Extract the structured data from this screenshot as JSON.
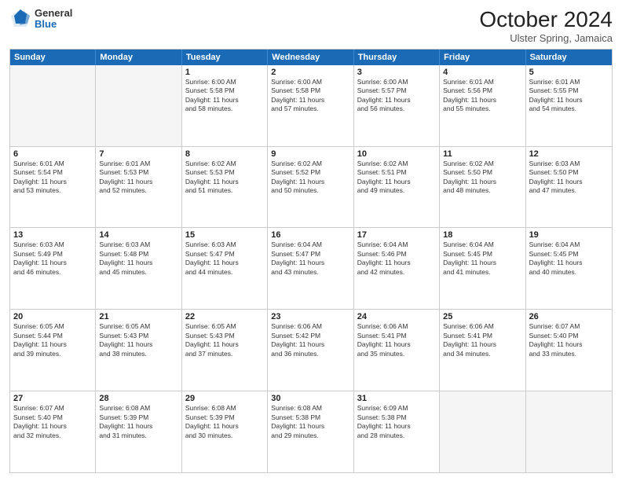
{
  "header": {
    "logo": {
      "general": "General",
      "blue": "Blue"
    },
    "title": "October 2024",
    "location": "Ulster Spring, Jamaica"
  },
  "calendar": {
    "days_of_week": [
      "Sunday",
      "Monday",
      "Tuesday",
      "Wednesday",
      "Thursday",
      "Friday",
      "Saturday"
    ],
    "weeks": [
      [
        {
          "day": "",
          "empty": true
        },
        {
          "day": "",
          "empty": true
        },
        {
          "day": "1",
          "lines": [
            "Sunrise: 6:00 AM",
            "Sunset: 5:58 PM",
            "Daylight: 11 hours",
            "and 58 minutes."
          ]
        },
        {
          "day": "2",
          "lines": [
            "Sunrise: 6:00 AM",
            "Sunset: 5:58 PM",
            "Daylight: 11 hours",
            "and 57 minutes."
          ]
        },
        {
          "day": "3",
          "lines": [
            "Sunrise: 6:00 AM",
            "Sunset: 5:57 PM",
            "Daylight: 11 hours",
            "and 56 minutes."
          ]
        },
        {
          "day": "4",
          "lines": [
            "Sunrise: 6:01 AM",
            "Sunset: 5:56 PM",
            "Daylight: 11 hours",
            "and 55 minutes."
          ]
        },
        {
          "day": "5",
          "lines": [
            "Sunrise: 6:01 AM",
            "Sunset: 5:55 PM",
            "Daylight: 11 hours",
            "and 54 minutes."
          ]
        }
      ],
      [
        {
          "day": "6",
          "lines": [
            "Sunrise: 6:01 AM",
            "Sunset: 5:54 PM",
            "Daylight: 11 hours",
            "and 53 minutes."
          ]
        },
        {
          "day": "7",
          "lines": [
            "Sunrise: 6:01 AM",
            "Sunset: 5:53 PM",
            "Daylight: 11 hours",
            "and 52 minutes."
          ]
        },
        {
          "day": "8",
          "lines": [
            "Sunrise: 6:02 AM",
            "Sunset: 5:53 PM",
            "Daylight: 11 hours",
            "and 51 minutes."
          ]
        },
        {
          "day": "9",
          "lines": [
            "Sunrise: 6:02 AM",
            "Sunset: 5:52 PM",
            "Daylight: 11 hours",
            "and 50 minutes."
          ]
        },
        {
          "day": "10",
          "lines": [
            "Sunrise: 6:02 AM",
            "Sunset: 5:51 PM",
            "Daylight: 11 hours",
            "and 49 minutes."
          ]
        },
        {
          "day": "11",
          "lines": [
            "Sunrise: 6:02 AM",
            "Sunset: 5:50 PM",
            "Daylight: 11 hours",
            "and 48 minutes."
          ]
        },
        {
          "day": "12",
          "lines": [
            "Sunrise: 6:03 AM",
            "Sunset: 5:50 PM",
            "Daylight: 11 hours",
            "and 47 minutes."
          ]
        }
      ],
      [
        {
          "day": "13",
          "lines": [
            "Sunrise: 6:03 AM",
            "Sunset: 5:49 PM",
            "Daylight: 11 hours",
            "and 46 minutes."
          ]
        },
        {
          "day": "14",
          "lines": [
            "Sunrise: 6:03 AM",
            "Sunset: 5:48 PM",
            "Daylight: 11 hours",
            "and 45 minutes."
          ]
        },
        {
          "day": "15",
          "lines": [
            "Sunrise: 6:03 AM",
            "Sunset: 5:47 PM",
            "Daylight: 11 hours",
            "and 44 minutes."
          ]
        },
        {
          "day": "16",
          "lines": [
            "Sunrise: 6:04 AM",
            "Sunset: 5:47 PM",
            "Daylight: 11 hours",
            "and 43 minutes."
          ]
        },
        {
          "day": "17",
          "lines": [
            "Sunrise: 6:04 AM",
            "Sunset: 5:46 PM",
            "Daylight: 11 hours",
            "and 42 minutes."
          ]
        },
        {
          "day": "18",
          "lines": [
            "Sunrise: 6:04 AM",
            "Sunset: 5:45 PM",
            "Daylight: 11 hours",
            "and 41 minutes."
          ]
        },
        {
          "day": "19",
          "lines": [
            "Sunrise: 6:04 AM",
            "Sunset: 5:45 PM",
            "Daylight: 11 hours",
            "and 40 minutes."
          ]
        }
      ],
      [
        {
          "day": "20",
          "lines": [
            "Sunrise: 6:05 AM",
            "Sunset: 5:44 PM",
            "Daylight: 11 hours",
            "and 39 minutes."
          ]
        },
        {
          "day": "21",
          "lines": [
            "Sunrise: 6:05 AM",
            "Sunset: 5:43 PM",
            "Daylight: 11 hours",
            "and 38 minutes."
          ]
        },
        {
          "day": "22",
          "lines": [
            "Sunrise: 6:05 AM",
            "Sunset: 5:43 PM",
            "Daylight: 11 hours",
            "and 37 minutes."
          ]
        },
        {
          "day": "23",
          "lines": [
            "Sunrise: 6:06 AM",
            "Sunset: 5:42 PM",
            "Daylight: 11 hours",
            "and 36 minutes."
          ]
        },
        {
          "day": "24",
          "lines": [
            "Sunrise: 6:06 AM",
            "Sunset: 5:41 PM",
            "Daylight: 11 hours",
            "and 35 minutes."
          ]
        },
        {
          "day": "25",
          "lines": [
            "Sunrise: 6:06 AM",
            "Sunset: 5:41 PM",
            "Daylight: 11 hours",
            "and 34 minutes."
          ]
        },
        {
          "day": "26",
          "lines": [
            "Sunrise: 6:07 AM",
            "Sunset: 5:40 PM",
            "Daylight: 11 hours",
            "and 33 minutes."
          ]
        }
      ],
      [
        {
          "day": "27",
          "lines": [
            "Sunrise: 6:07 AM",
            "Sunset: 5:40 PM",
            "Daylight: 11 hours",
            "and 32 minutes."
          ]
        },
        {
          "day": "28",
          "lines": [
            "Sunrise: 6:08 AM",
            "Sunset: 5:39 PM",
            "Daylight: 11 hours",
            "and 31 minutes."
          ]
        },
        {
          "day": "29",
          "lines": [
            "Sunrise: 6:08 AM",
            "Sunset: 5:39 PM",
            "Daylight: 11 hours",
            "and 30 minutes."
          ]
        },
        {
          "day": "30",
          "lines": [
            "Sunrise: 6:08 AM",
            "Sunset: 5:38 PM",
            "Daylight: 11 hours",
            "and 29 minutes."
          ]
        },
        {
          "day": "31",
          "lines": [
            "Sunrise: 6:09 AM",
            "Sunset: 5:38 PM",
            "Daylight: 11 hours",
            "and 28 minutes."
          ]
        },
        {
          "day": "",
          "empty": true
        },
        {
          "day": "",
          "empty": true
        }
      ]
    ]
  }
}
